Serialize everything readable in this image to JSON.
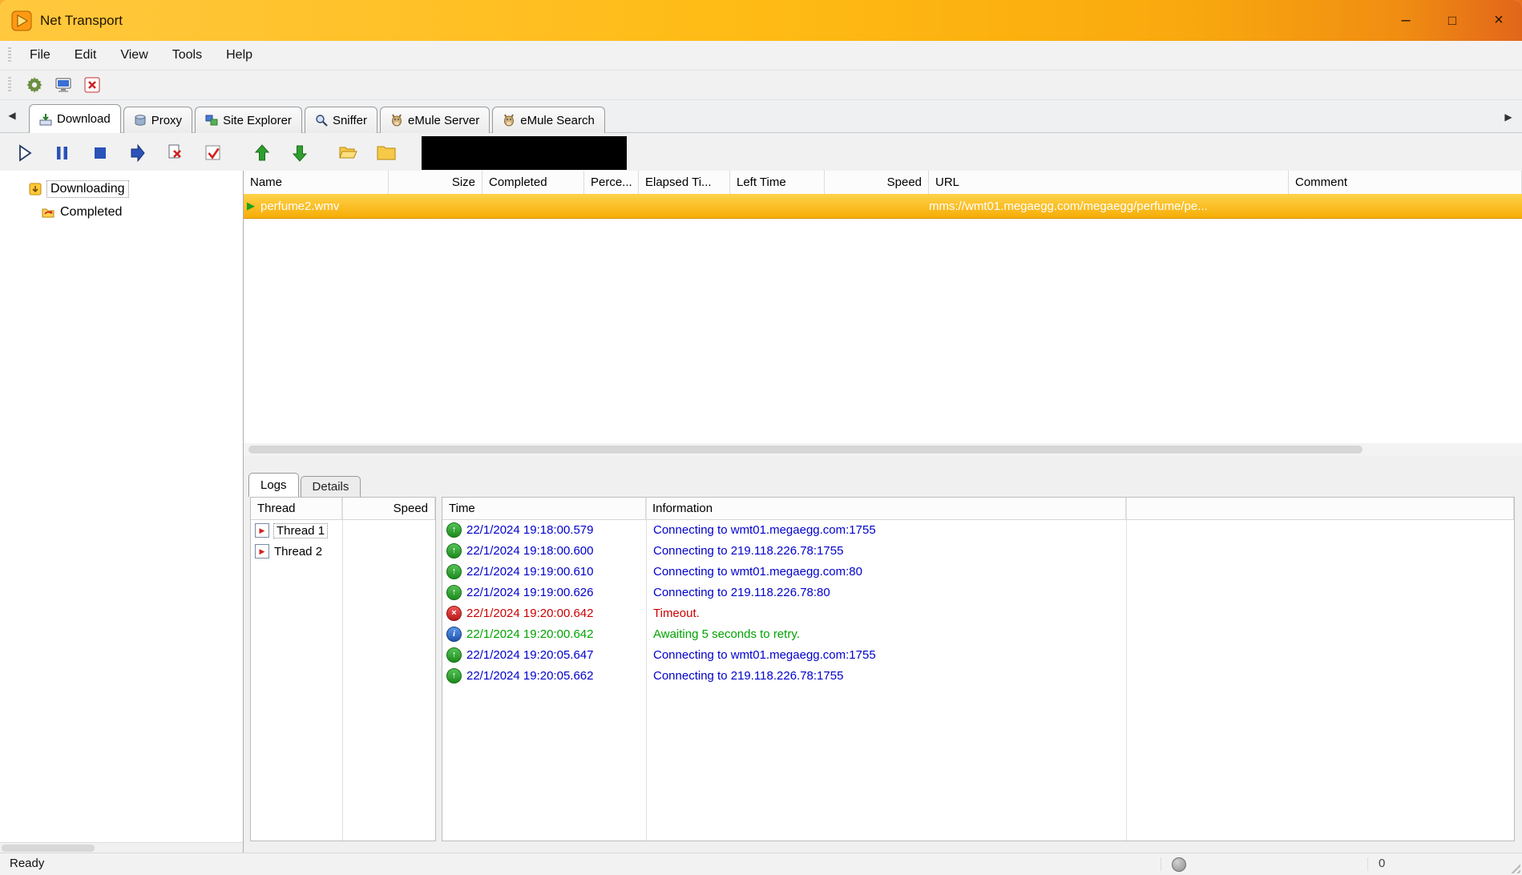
{
  "window": {
    "title": "Net Transport"
  },
  "icons": {
    "minimize": "–",
    "maximize": "□",
    "close": "×",
    "tab_scroll_left": "◀",
    "tab_scroll_right": "▶",
    "row_marker": "▶",
    "thread_marker": "▶",
    "log_connect": "↑",
    "log_error": "×",
    "log_info": "i"
  },
  "menu": {
    "items": [
      "File",
      "Edit",
      "View",
      "Tools",
      "Help"
    ]
  },
  "tabs": [
    {
      "label": "Download",
      "active": true
    },
    {
      "label": "Proxy",
      "active": false
    },
    {
      "label": "Site Explorer",
      "active": false
    },
    {
      "label": "Sniffer",
      "active": false
    },
    {
      "label": "eMule Server",
      "active": false
    },
    {
      "label": "eMule Search",
      "active": false
    }
  ],
  "sidebar": {
    "items": [
      {
        "label": "Downloading",
        "selected": true
      },
      {
        "label": "Completed",
        "selected": false
      }
    ]
  },
  "downloads": {
    "columns": [
      "Name",
      "Size",
      "Completed",
      "Perce...",
      "Elapsed Ti...",
      "Left Time",
      "Speed",
      "URL",
      "Comment"
    ],
    "rows": [
      {
        "name": "perfume2.wmv",
        "url": "mms://wmt01.megaegg.com/megaegg/perfume/pe..."
      }
    ]
  },
  "bottom_tabs": [
    {
      "label": "Logs",
      "active": true
    },
    {
      "label": "Details",
      "active": false
    }
  ],
  "threads": {
    "columns": [
      "Thread",
      "Speed"
    ],
    "rows": [
      {
        "label": "Thread 1"
      },
      {
        "label": "Thread 2"
      }
    ]
  },
  "logs": {
    "columns": [
      "Time",
      "Information"
    ],
    "entries": [
      {
        "time": "22/1/2024 19:18:00.579",
        "info": "Connecting to wmt01.megaegg.com:1755",
        "type": "connect"
      },
      {
        "time": "22/1/2024 19:18:00.600",
        "info": "Connecting to 219.118.226.78:1755",
        "type": "connect"
      },
      {
        "time": "22/1/2024 19:19:00.610",
        "info": "Connecting to wmt01.megaegg.com:80",
        "type": "connect"
      },
      {
        "time": "22/1/2024 19:19:00.626",
        "info": "Connecting to 219.118.226.78:80",
        "type": "connect"
      },
      {
        "time": "22/1/2024 19:20:00.642",
        "info": "Timeout.",
        "type": "error"
      },
      {
        "time": "22/1/2024 19:20:00.642",
        "info": "Awaiting 5 seconds to retry.",
        "type": "info"
      },
      {
        "time": "22/1/2024 19:20:05.647",
        "info": "Connecting to wmt01.megaegg.com:1755",
        "type": "connect"
      },
      {
        "time": "22/1/2024 19:20:05.662",
        "info": "Connecting to 219.118.226.78:1755",
        "type": "connect"
      }
    ]
  },
  "status": {
    "ready": "Ready",
    "counter": "0"
  },
  "colors": {
    "titlebar_gold": "#ffbb14",
    "selected_row_gold": "#f6ad06",
    "log_connect_text": "#0000cc",
    "log_error_text": "#cc0000",
    "log_info_text": "#00a300"
  }
}
